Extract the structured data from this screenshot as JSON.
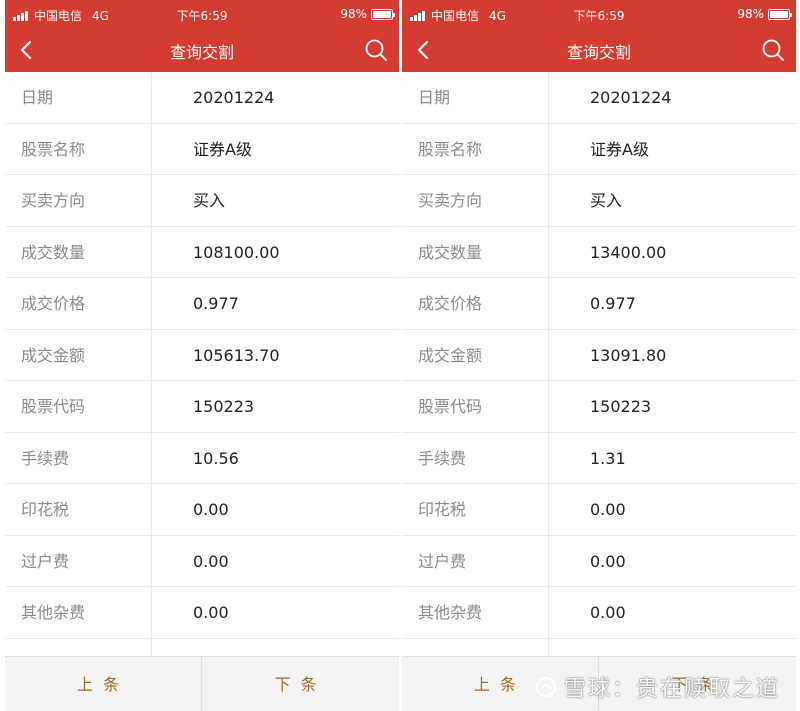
{
  "status_bar": {
    "carrier": "中国电信",
    "network": "4G",
    "time": "下午6:59",
    "battery": "98%",
    "battery_level": 0.98
  },
  "header": {
    "title": "查询交割"
  },
  "colors": {
    "brand": "#d43c32",
    "footer_text": "#a06a22"
  },
  "icons": {
    "back": "chevron-left-icon",
    "search": "search-icon"
  },
  "records": [
    {
      "rows": [
        {
          "label": "日期",
          "value": "20201224"
        },
        {
          "label": "股票名称",
          "value": "证券A级"
        },
        {
          "label": "买卖方向",
          "value": "买入"
        },
        {
          "label": "成交数量",
          "value": "108100.00"
        },
        {
          "label": "成交价格",
          "value": "0.977"
        },
        {
          "label": "成交金额",
          "value": "105613.70"
        },
        {
          "label": "股票代码",
          "value": "150223"
        },
        {
          "label": "手续费",
          "value": "10.56"
        },
        {
          "label": "印花税",
          "value": "0.00"
        },
        {
          "label": "过户费",
          "value": "0.00"
        },
        {
          "label": "其他杂费",
          "value": "0.00"
        },
        {
          "label": "",
          "value": ""
        }
      ]
    },
    {
      "rows": [
        {
          "label": "日期",
          "value": "20201224"
        },
        {
          "label": "股票名称",
          "value": "证券A级"
        },
        {
          "label": "买卖方向",
          "value": "买入"
        },
        {
          "label": "成交数量",
          "value": "13400.00"
        },
        {
          "label": "成交价格",
          "value": "0.977"
        },
        {
          "label": "成交金额",
          "value": "13091.80"
        },
        {
          "label": "股票代码",
          "value": "150223"
        },
        {
          "label": "手续费",
          "value": "1.31"
        },
        {
          "label": "印花税",
          "value": "0.00"
        },
        {
          "label": "过户费",
          "value": "0.00"
        },
        {
          "label": "其他杂费",
          "value": "0.00"
        },
        {
          "label": "",
          "value": ""
        }
      ]
    }
  ],
  "footer": {
    "prev_label": "上条",
    "next_label": "下条"
  },
  "watermark": {
    "text": "雪球：贵在赎取之道"
  }
}
